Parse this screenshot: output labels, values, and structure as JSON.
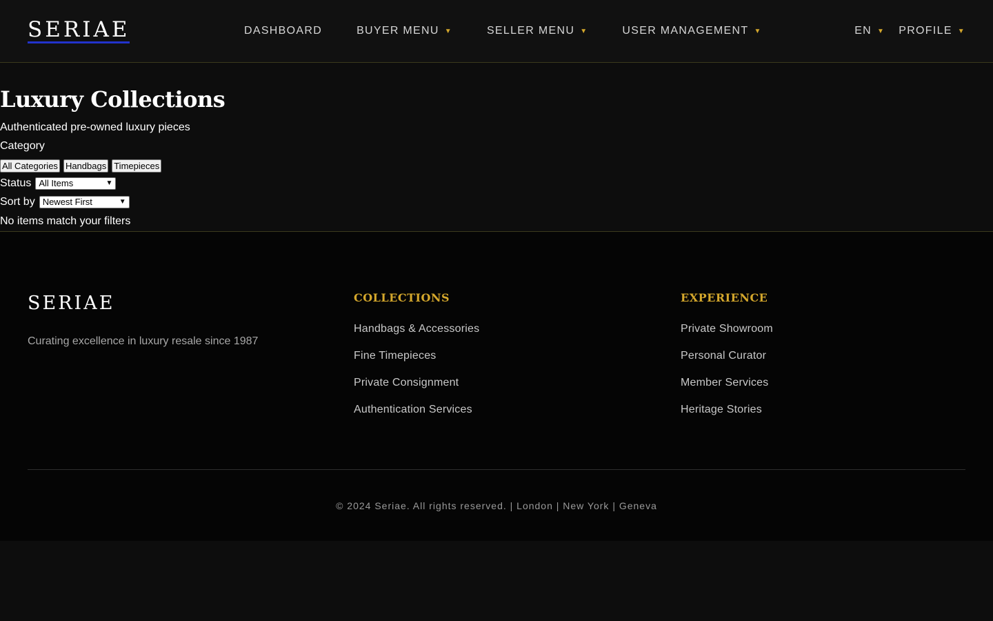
{
  "brand": {
    "logo": "SERIAE"
  },
  "nav": {
    "items": [
      {
        "label": "DASHBOARD",
        "dropdown": false
      },
      {
        "label": "BUYER MENU",
        "dropdown": true
      },
      {
        "label": "SELLER MENU",
        "dropdown": true
      },
      {
        "label": "USER MANAGEMENT",
        "dropdown": true
      }
    ],
    "language": "EN",
    "profile": "PROFILE",
    "caret": "▼"
  },
  "main": {
    "title": "Luxury Collections",
    "subtitle": "Authenticated pre-owned luxury pieces",
    "category_label": "Category",
    "categories": [
      "All Categories",
      "Handbags",
      "Timepieces"
    ],
    "status_label": "Status",
    "status_value": "All Items",
    "sort_label": "Sort by",
    "sort_value": "Newest First",
    "empty_message": "No items match your filters"
  },
  "footer": {
    "logo": "SERIAE",
    "tagline": "Curating excellence in luxury resale since 1987",
    "collections": {
      "heading": "COLLECTIONS",
      "links": [
        "Handbags & Accessories",
        "Fine Timepieces",
        "Private Consignment",
        "Authentication Services"
      ]
    },
    "experience": {
      "heading": "EXPERIENCE",
      "links": [
        "Private Showroom",
        "Personal Curator",
        "Member Services",
        "Heritage Stories"
      ]
    },
    "copyright": "© 2024 Seriae. All rights reserved. | London | New York | Geneva"
  },
  "colors": {
    "accent": "#d4a72c",
    "background": "#0d0d0d",
    "navbar": "#111111",
    "footer": "#050505"
  }
}
